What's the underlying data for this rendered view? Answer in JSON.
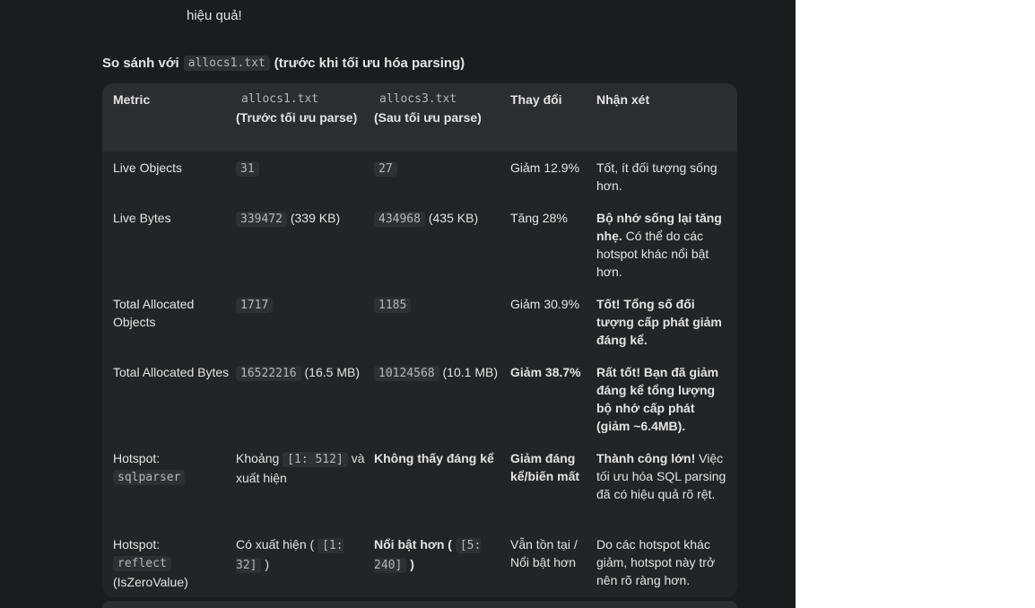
{
  "prev_text": "hiệu quả!",
  "heading": {
    "prefix": "So sánh với",
    "code": "allocs1.txt",
    "suffix": "(trước khi tối ưu hóa parsing)"
  },
  "table": {
    "headers": {
      "metric": "Metric",
      "col2_code": "allocs1.txt",
      "col2_label": "(Trước tối ưu parse)",
      "col3_code": "allocs3.txt",
      "col3_label": "(Sau tối ưu parse)",
      "change": "Thay đổi",
      "note": "Nhận xét"
    },
    "rows": [
      {
        "metric": "Live Objects",
        "v1_code": "31",
        "v2_code": "27",
        "change": "Giảm 12.9%",
        "note": "Tốt, ít đối tượng sống hơn."
      },
      {
        "metric": "Live Bytes",
        "v1_code": "339472",
        "v1_text": "(339 KB)",
        "v2_code": "434968",
        "v2_text": "(435 KB)",
        "change": "Tăng 28%",
        "note_bold": "Bộ nhớ sống lại tăng nhẹ.",
        "note": "Có thể do các hotspot khác nổi bật hơn."
      },
      {
        "metric": "Total Allocated Objects",
        "v1_code": "1717",
        "v2_code": "1185",
        "change": "Giảm 30.9%",
        "note_bold": "Tốt! Tổng số đối tượng cấp phát giảm đáng kể."
      },
      {
        "metric": "Total Allocated Bytes",
        "v1_code": "16522216",
        "v1_text": "(16.5 MB)",
        "v2_code": "10124568",
        "v2_text": "(10.1 MB)",
        "change_bold": "Giảm 38.7%",
        "note_bold": "Rất tốt! Bạn đã giảm đáng kể tổng lượng bộ nhớ cấp phát (giảm ~6.4MB)."
      },
      {
        "metric": "Hotspot:",
        "metric_code": "sqlparser",
        "v1_prefix": "Khoảng",
        "v1_code": "[1: 512]",
        "v1_text": "và xuất hiện",
        "v2_bold": "Không thấy đáng kể",
        "change_bold": "Giảm đáng kể/biến mất",
        "note_bold": "Thành công lớn!",
        "note": "Việc tối ưu hóa SQL parsing đã có hiệu quả rõ rệt."
      },
      {
        "metric": "Hotspot:",
        "metric_code": "reflect",
        "metric_suffix": "(IsZeroValue)",
        "v1_prefix": "Có xuất hiện (",
        "v1_code": "[1: 32]",
        "v1_text": ")",
        "v2_bold_prefix": "Nổi bật hơn (",
        "v2_code": "[5: 240]",
        "v2_bold_suffix": ")",
        "change": "Vẫn tồn tại / Nổi bật hơn",
        "note": "Do các hotspot khác giảm, hotspot này trở nên rõ ràng hơn."
      }
    ]
  }
}
